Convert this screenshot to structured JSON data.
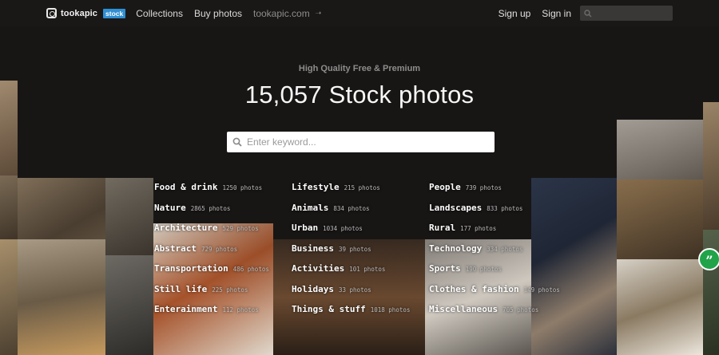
{
  "brand": {
    "name": "tookapic",
    "badge": "stock"
  },
  "nav": {
    "collections": "Collections",
    "buy_photos": "Buy photos",
    "domain": "tookapic.com",
    "sign_up": "Sign up",
    "sign_in": "Sign in"
  },
  "hero": {
    "tagline": "High Quality Free & Premium",
    "headline": "15,057 Stock photos",
    "search_placeholder": "Enter keyword..."
  },
  "categories": [
    [
      {
        "name": "Food & drink",
        "count": "1250 photos"
      },
      {
        "name": "Nature",
        "count": "2865 photos"
      },
      {
        "name": "Architecture",
        "count": "529 photos"
      },
      {
        "name": "Abstract",
        "count": "729 photos"
      },
      {
        "name": "Transportation",
        "count": "486 photos"
      },
      {
        "name": "Still life",
        "count": "225 photos"
      },
      {
        "name": "Enterainment",
        "count": "112 photos"
      }
    ],
    [
      {
        "name": "Lifestyle",
        "count": "215 photos"
      },
      {
        "name": "Animals",
        "count": "834 photos"
      },
      {
        "name": "Urban",
        "count": "1034 photos"
      },
      {
        "name": "Business",
        "count": "39 photos"
      },
      {
        "name": "Activities",
        "count": "101 photos"
      },
      {
        "name": "Holidays",
        "count": "33 photos"
      },
      {
        "name": "Things & stuff",
        "count": "1018 photos"
      }
    ],
    [
      {
        "name": "People",
        "count": "739 photos"
      },
      {
        "name": "Landscapes",
        "count": "833 photos"
      },
      {
        "name": "Rural",
        "count": "177 photos"
      },
      {
        "name": "Technology",
        "count": "334 photos"
      },
      {
        "name": "Sports",
        "count": "190 photos"
      },
      {
        "name": "Clothes & fashion",
        "count": "149 photos"
      },
      {
        "name": "Miscellaneous",
        "count": "705 photos"
      }
    ]
  ],
  "colors": {
    "background": "#181615",
    "badge": "#2f8fd3",
    "feedback": "#21a34a"
  },
  "icons": {
    "logo": "camera-logo-icon",
    "domain_link": "arrow-right-icon",
    "search": "search-icon",
    "feedback": "quote-icon"
  }
}
